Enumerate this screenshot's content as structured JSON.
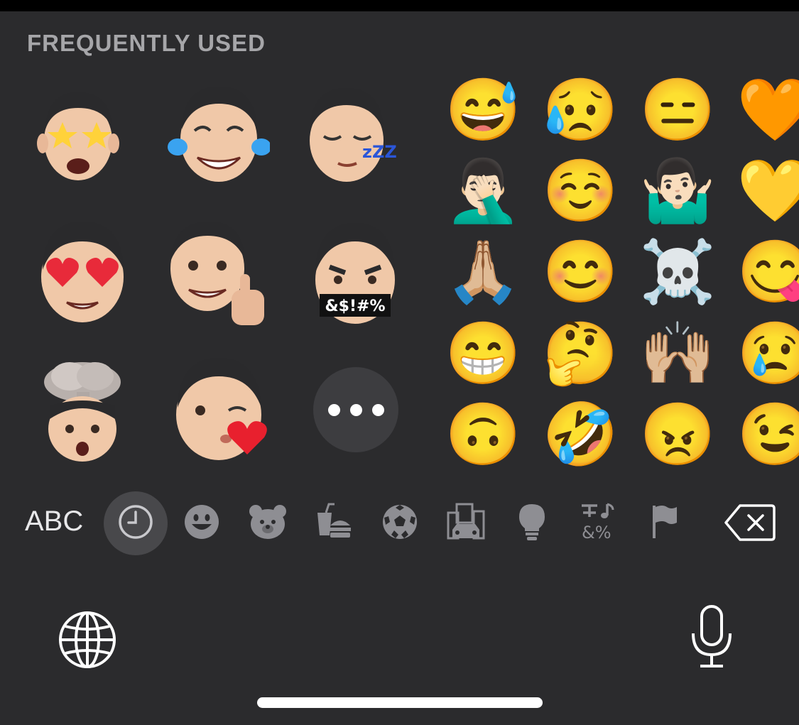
{
  "section": {
    "title": "FREQUENTLY USED"
  },
  "memojis": [
    {
      "name": "star-struck-memoji"
    },
    {
      "name": "laughing-tears-memoji"
    },
    {
      "name": "sleeping-memoji",
      "zzz": "zZZ"
    },
    {
      "name": "heart-eyes-memoji"
    },
    {
      "name": "thumbs-up-memoji"
    },
    {
      "name": "cursing-memoji",
      "mask_text": "&$!#%"
    },
    {
      "name": "mind-blown-memoji"
    },
    {
      "name": "kiss-heart-memoji"
    }
  ],
  "more_button": {
    "icon": "more-icon"
  },
  "emojis": [
    [
      "😅",
      "😥",
      "😑",
      "🧡"
    ],
    [
      "🤦🏻‍♂️",
      "☺️",
      "🤷🏻‍♂️",
      "💛"
    ],
    [
      "🙏🏼",
      "😊",
      "☠️",
      "😋"
    ],
    [
      "😁",
      "🤔",
      "🙌🏼",
      "😢"
    ],
    [
      "🙃",
      "🤣",
      "😠",
      "😉"
    ]
  ],
  "categories": {
    "abc_label": "ABC",
    "items": [
      {
        "icon": "clock-icon",
        "label": "Frequently Used",
        "selected": true
      },
      {
        "icon": "smiley-icon",
        "label": "Smileys & People"
      },
      {
        "icon": "bear-icon",
        "label": "Animals & Nature"
      },
      {
        "icon": "food-icon",
        "label": "Food & Drink"
      },
      {
        "icon": "soccer-ball-icon",
        "label": "Activity"
      },
      {
        "icon": "city-car-icon",
        "label": "Travel & Places"
      },
      {
        "icon": "lightbulb-icon",
        "label": "Objects"
      },
      {
        "icon": "symbols-icon",
        "label": "Symbols",
        "glyph_text": "&%"
      },
      {
        "icon": "flag-icon",
        "label": "Flags"
      }
    ],
    "delete": {
      "icon": "delete-backward-icon"
    }
  },
  "bottom": {
    "globe_icon": "globe-icon",
    "mic_icon": "microphone-icon"
  },
  "colors": {
    "background": "#2b2b2d",
    "title": "#a6a6a9",
    "icon_gray": "#8e8e93",
    "selected_bg": "#48484b"
  }
}
